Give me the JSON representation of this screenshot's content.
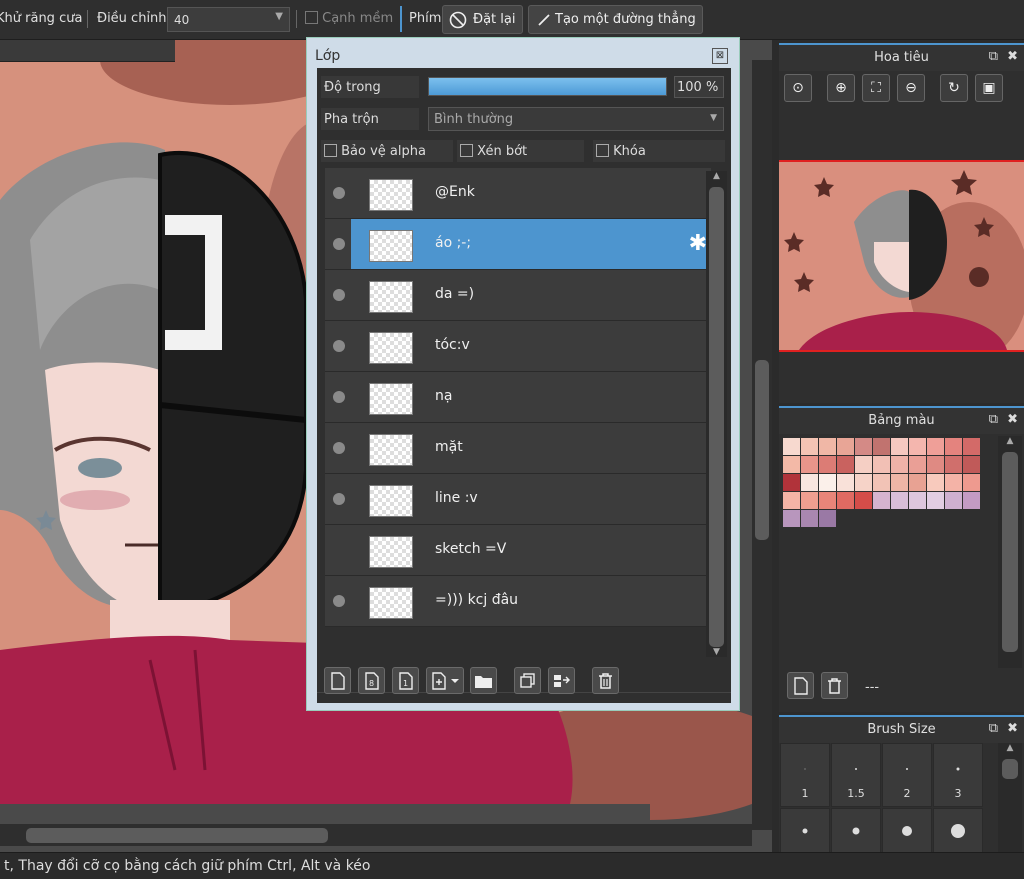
{
  "toolbar": {
    "antialias_label": "Khử răng cưa",
    "adjust_label": "Điều chỉnh",
    "adjust_value": "40",
    "soft_edge_label": "Cạnh mềm",
    "key_label": "Phím",
    "reset_label": "Đặt lại",
    "line_label": "Tạo một đường thẳng"
  },
  "layers": {
    "title": "Lớp",
    "opacity_label": "Độ trong",
    "opacity_value": "100 %",
    "opacity_fraction": 1.0,
    "blend_label": "Pha trộn",
    "blend_value": "Bình thường",
    "protect_alpha_label": "Bảo vệ alpha",
    "clipping_label": "Xén bớt",
    "lock_label": "Khóa",
    "items": [
      {
        "name": "@Enk",
        "visible": true,
        "selected": false
      },
      {
        "name": "áo ;-;",
        "visible": true,
        "selected": true
      },
      {
        "name": "da =)",
        "visible": true,
        "selected": false
      },
      {
        "name": "tóc:v",
        "visible": true,
        "selected": false
      },
      {
        "name": "nạ",
        "visible": true,
        "selected": false
      },
      {
        "name": "mặt",
        "visible": true,
        "selected": false
      },
      {
        "name": "line :v",
        "visible": true,
        "selected": false
      },
      {
        "name": "sketch =V",
        "visible": false,
        "selected": false
      },
      {
        "name": "=))) kcj đâu",
        "visible": true,
        "selected": false
      }
    ]
  },
  "navigator": {
    "title": "Hoa tiêu"
  },
  "palette": {
    "title": "Bảng màu",
    "label": "---",
    "colors": [
      [
        "#f7d9cf",
        "#f4c4b4",
        "#f0b7a6",
        "#e8a596",
        "#d48a86",
        "#c1736f",
        "#f6c8c0",
        "#f4b6ae",
        "#ef9f98",
        "#e4837e",
        "#d36a68"
      ],
      [
        "#f3b9a7",
        "#e9958a",
        "#dc7c75",
        "#c9625f",
        "#f5cfc4",
        "#f2c0b5",
        "#efb2a8",
        "#ea9f96",
        "#df8a83",
        "#d06f6c",
        "#c05a59"
      ],
      [
        "#b1333a",
        "#f8e6df",
        "#fbf0ea",
        "#f9e1d9",
        "#f6d3c8",
        "#f2c3b6",
        "#eeb5a6",
        "#e8a293",
        "#f8cabd",
        "#f4b3a7",
        "#ee9a8f"
      ],
      [
        "#f5b4a6",
        "#f09f90",
        "#e98579",
        "#e06a62",
        "#d44d49",
        "#d6b4cf",
        "#d9bed8",
        "#dec6dd",
        "#e2cde2",
        "#cfb0d0",
        "#c49bc4"
      ],
      [
        "#b896bd",
        "#a987b0",
        "#9a79a5"
      ]
    ]
  },
  "brush_size": {
    "title": "Brush Size",
    "sizes": [
      "1",
      "1.5",
      "2",
      "3"
    ]
  },
  "status": {
    "text": "t, Thay đổi cỡ cọ bằng cách giữ phím Ctrl, Alt và kéo"
  }
}
